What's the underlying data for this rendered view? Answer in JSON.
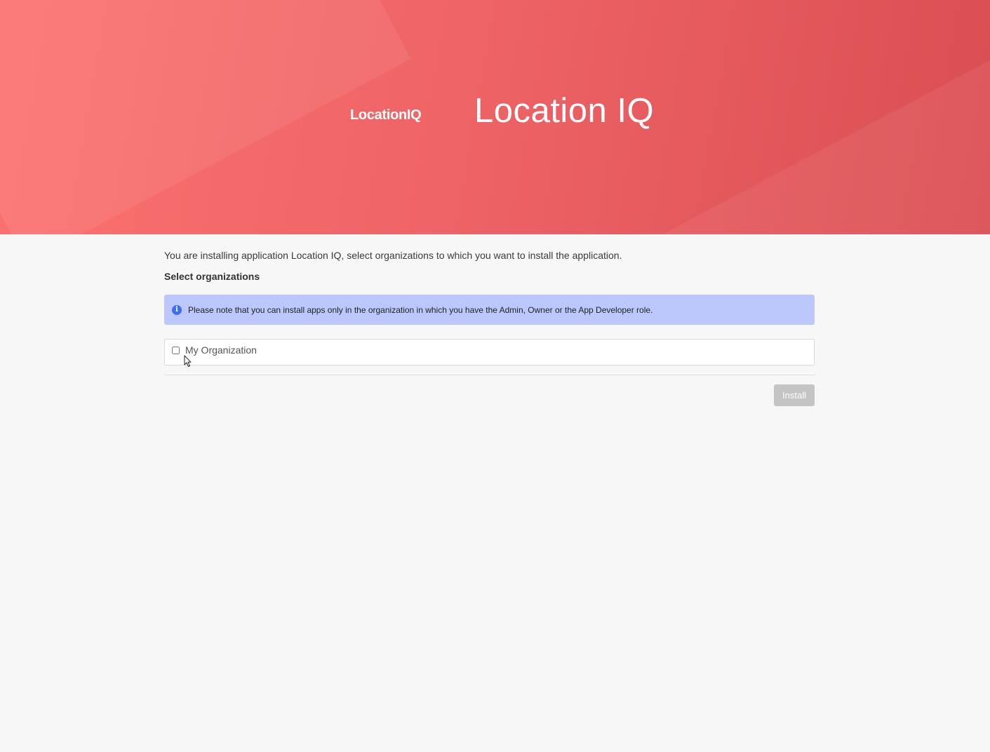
{
  "header": {
    "logo_text": "LocationIQ",
    "title": "Location IQ",
    "gradient_start": "#fb7270",
    "gradient_end": "#da4e53"
  },
  "main": {
    "intro_text": "You are installing application Location IQ, select organizations to which you want to install the application.",
    "section_title": "Select organizations",
    "notice": {
      "icon": "info-icon",
      "text": "Please note that you can install apps only in the organization in which you have the Admin, Owner or the App Developer role."
    },
    "organizations": [
      {
        "label": "My Organization",
        "checked": false
      }
    ],
    "install_label": "Install"
  }
}
